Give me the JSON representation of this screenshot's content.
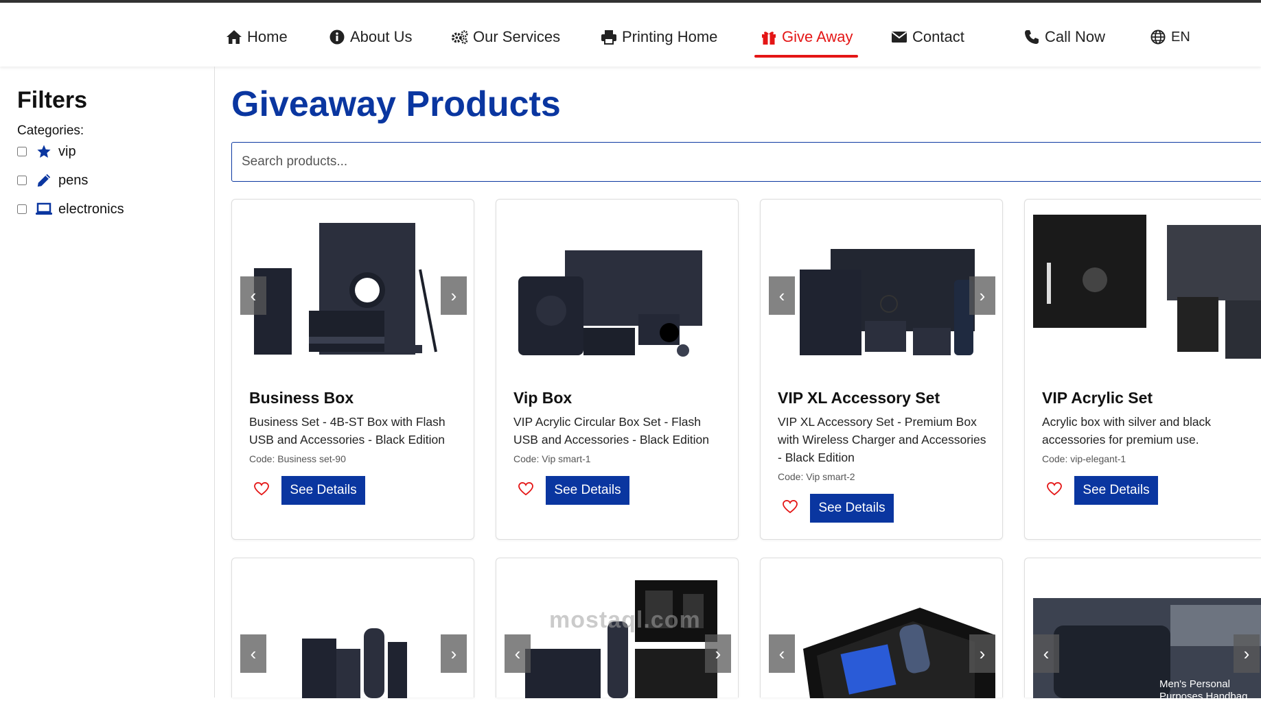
{
  "nav": {
    "items": [
      {
        "label": "Home",
        "icon": "home-icon"
      },
      {
        "label": "About Us",
        "icon": "info-icon"
      },
      {
        "label": "Our Services",
        "icon": "gears-icon"
      },
      {
        "label": "Printing Home",
        "icon": "printer-icon"
      },
      {
        "label": "Give Away",
        "icon": "gift-icon",
        "active": true
      },
      {
        "label": "Contact",
        "icon": "envelope-icon"
      },
      {
        "label": "Call Now",
        "icon": "phone-icon"
      },
      {
        "label": "EN",
        "icon": "globe-icon"
      }
    ],
    "active_color": "#e41616"
  },
  "sidebar": {
    "title": "Filters",
    "categories_label": "Categories:",
    "categories": [
      {
        "label": "vip",
        "icon": "star-icon",
        "checked": false
      },
      {
        "label": "pens",
        "icon": "pen-icon",
        "checked": false
      },
      {
        "label": "electronics",
        "icon": "laptop-icon",
        "checked": false
      }
    ]
  },
  "main": {
    "title": "Giveaway Products",
    "search_placeholder": "Search products...",
    "details_label": "See Details",
    "products": [
      {
        "name": "Business Box",
        "description": "Business Set - 4B-ST Box with Flash USB and Accessories - Black Edition",
        "code": "Code: Business set-90"
      },
      {
        "name": "Vip Box",
        "description": "VIP Acrylic Circular Box Set - Flash USB and Accessories - Black Edition",
        "code": "Code: Vip smart-1"
      },
      {
        "name": "VIP XL Accessory Set",
        "description": "VIP XL Accessory Set - Premium Box with Wireless Charger and Accessories - Black Edition",
        "code": "Code: Vip smart-2"
      },
      {
        "name": "VIP Acrylic Set",
        "description": "Acrylic box with silver and black accessories for premium use.",
        "code": "Code: vip-elegant-1"
      }
    ],
    "second_row_caption": "Men's Personal Purposes Handbag"
  },
  "watermark": "mostaql.com",
  "colors": {
    "brand": "#0a36a0",
    "accent": "#e41616"
  }
}
